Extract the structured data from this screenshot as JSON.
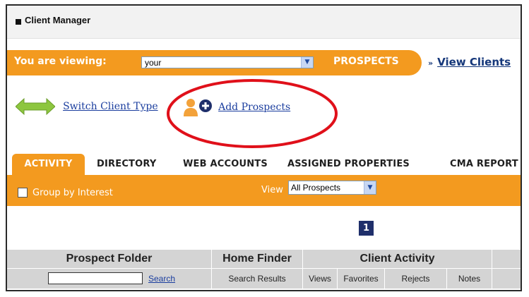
{
  "header": {
    "title": "Client Manager"
  },
  "viewbar": {
    "label": "You are viewing:",
    "selected": "your",
    "type_label": "PROSPECTS",
    "view_clients_prefix": "»",
    "view_clients_link": "View Clients"
  },
  "actions": {
    "switch_client_type": "Switch Client Type",
    "add_prospects": "Add Prospects"
  },
  "tabs": [
    "ACTIVITY",
    "DIRECTORY",
    "WEB ACCOUNTS",
    "ASSIGNED PROPERTIES",
    "CMA REPORT"
  ],
  "filter": {
    "group_by_interest": "Group by Interest",
    "view_label": "View",
    "view_selected": "All Prospects"
  },
  "pagination": {
    "current_page": "1"
  },
  "table": {
    "group_headers": [
      "Prospect Folder",
      "Home Finder",
      "Client Activity"
    ],
    "search_placeholder": "",
    "search_link": "Search",
    "sub_headers": [
      "Search Results",
      "Views",
      "Favorites",
      "Rejects",
      "Notes"
    ]
  },
  "colors": {
    "accent": "#f39a1f",
    "link": "#1a3d9e",
    "annotation": "#e0101a"
  }
}
